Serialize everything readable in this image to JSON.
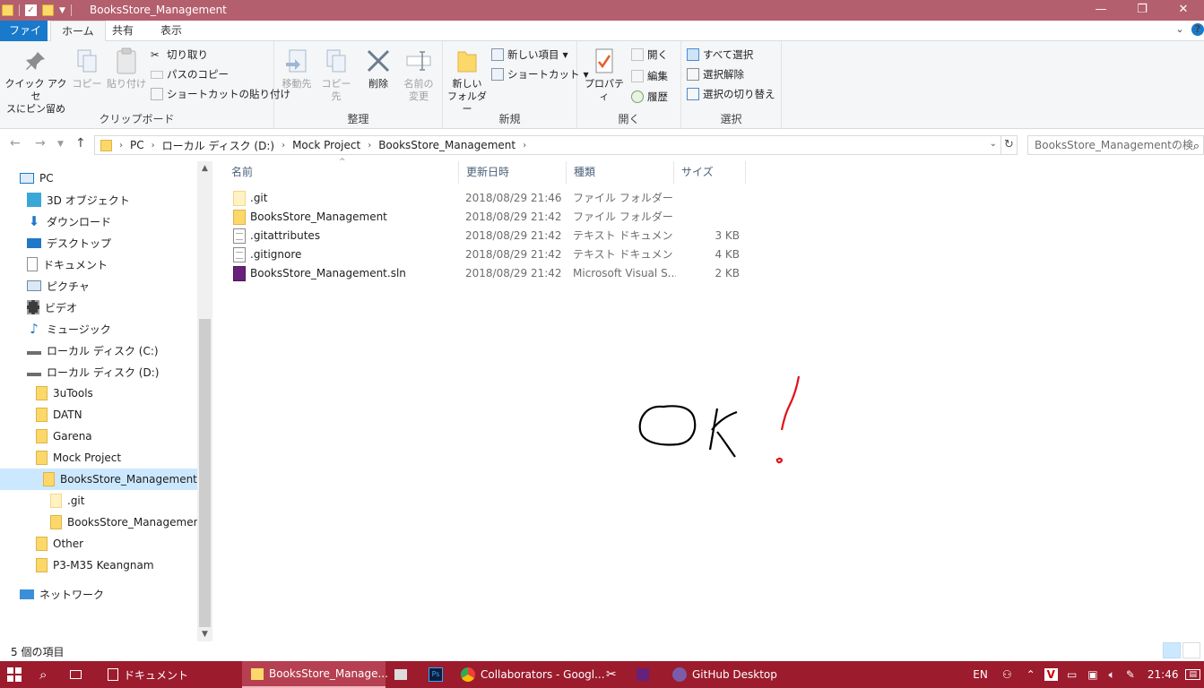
{
  "window": {
    "title": "BooksStore_Management",
    "controls": {
      "minimize": "—",
      "maximize": "❐",
      "close": "✕"
    }
  },
  "tabs": [
    {
      "label": "ファイル"
    },
    {
      "label": "ホーム"
    },
    {
      "label": "共有"
    },
    {
      "label": "表示"
    }
  ],
  "ribbon": {
    "clipboard": {
      "group_label": "クリップボード",
      "pin_label": "クイック アクセ\nスにピン留め",
      "copy_label": "コピー",
      "paste_label": "貼り付け",
      "cut_label": "切り取り",
      "copy_path_label": "パスのコピー",
      "paste_shortcut_label": "ショートカットの貼り付け"
    },
    "organize": {
      "group_label": "整理",
      "move_to_label": "移動先",
      "copy_to_label": "コピー先",
      "delete_label": "削除",
      "rename_label": "名前の\n変更"
    },
    "new": {
      "group_label": "新規",
      "new_folder_label": "新しい\nフォルダー",
      "new_item_label": "新しい項目",
      "shortcut_label": "ショートカット"
    },
    "open": {
      "group_label": "開く",
      "properties_label": "プロパティ",
      "open_label": "開く",
      "edit_label": "編集",
      "history_label": "履歴"
    },
    "select": {
      "group_label": "選択",
      "select_all_label": "すべて選択",
      "select_none_label": "選択解除",
      "invert_label": "選択の切り替え"
    }
  },
  "address": {
    "crumbs": [
      "PC",
      "ローカル ディスク (D:)",
      "Mock Project",
      "BooksStore_Management"
    ],
    "search_placeholder": "BooksStore_Managementの検"
  },
  "nav_tree": [
    {
      "label": "PC",
      "icon": "pc-icon"
    },
    {
      "label": "3D オブジェクト",
      "icon": "3d-objects-icon"
    },
    {
      "label": "ダウンロード",
      "icon": "download-icon"
    },
    {
      "label": "デスクトップ",
      "icon": "desktop-icon"
    },
    {
      "label": "ドキュメント",
      "icon": "documents-icon"
    },
    {
      "label": "ピクチャ",
      "icon": "pictures-icon"
    },
    {
      "label": "ビデオ",
      "icon": "videos-icon"
    },
    {
      "label": "ミュージック",
      "icon": "music-icon"
    },
    {
      "label": "ローカル ディスク (C:)",
      "icon": "drive-icon"
    },
    {
      "label": "ローカル ディスク (D:)",
      "icon": "drive-icon"
    },
    {
      "label": "3uTools",
      "icon": "folder-icon"
    },
    {
      "label": "DATN",
      "icon": "folder-icon"
    },
    {
      "label": "Garena",
      "icon": "folder-icon"
    },
    {
      "label": "Mock Project",
      "icon": "folder-icon"
    },
    {
      "label": "BooksStore_Management",
      "icon": "folder-icon",
      "selected": true
    },
    {
      "label": ".git",
      "icon": "folder-icon"
    },
    {
      "label": "BooksStore_Management",
      "icon": "folder-icon"
    },
    {
      "label": "Other",
      "icon": "folder-icon"
    },
    {
      "label": "P3-M35 Keangnam",
      "icon": "folder-icon"
    },
    {
      "label": "ネットワーク",
      "icon": "network-icon"
    }
  ],
  "file_list": {
    "columns": [
      "名前",
      "更新日時",
      "種類",
      "サイズ"
    ],
    "rows": [
      {
        "name": ".git",
        "date": "2018/08/29 21:46",
        "type": "ファイル フォルダー",
        "size": "",
        "icon": "folder-icon"
      },
      {
        "name": "BooksStore_Management",
        "date": "2018/08/29 21:42",
        "type": "ファイル フォルダー",
        "size": "",
        "icon": "folder-icon"
      },
      {
        "name": ".gitattributes",
        "date": "2018/08/29 21:42",
        "type": "テキスト ドキュメント",
        "size": "3 KB",
        "icon": "text-file-icon"
      },
      {
        "name": ".gitignore",
        "date": "2018/08/29 21:42",
        "type": "テキスト ドキュメント",
        "size": "4 KB",
        "icon": "text-file-icon"
      },
      {
        "name": "BooksStore_Management.sln",
        "date": "2018/08/29 21:42",
        "type": "Microsoft Visual S...",
        "size": "2 KB",
        "icon": "visual-studio-solution-icon"
      }
    ]
  },
  "status": {
    "item_count": "5 個の項目"
  },
  "taskbar": {
    "items": [
      {
        "label": "ドキュメント"
      },
      {
        "label": "BooksStore_Manage..."
      },
      {
        "label": "Collaborators - Googl..."
      },
      {
        "label": "GitHub Desktop"
      }
    ],
    "lang": "EN",
    "clock": "21:46"
  },
  "colors": {
    "titlebar": "#b45f6e",
    "taskbar": "#9c1b2d",
    "accent": "#1979ca",
    "selection": "#cce8ff",
    "drawing_black": "#000000",
    "drawing_red": "#e0101a"
  }
}
